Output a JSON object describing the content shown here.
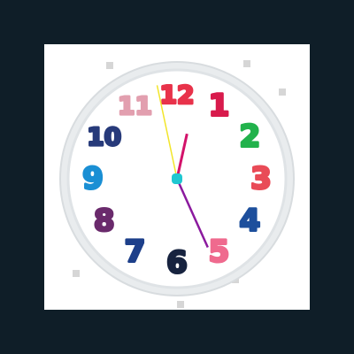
{
  "clock": {
    "numerals": [
      {
        "label": "12",
        "hour": 12,
        "color": "#e8324a"
      },
      {
        "label": "1",
        "hour": 1,
        "color": "#d81b4c"
      },
      {
        "label": "2",
        "hour": 2,
        "color": "#22b24c"
      },
      {
        "label": "3",
        "hour": 3,
        "color": "#e94b57"
      },
      {
        "label": "4",
        "hour": 4,
        "color": "#1d4f9c"
      },
      {
        "label": "5",
        "hour": 5,
        "color": "#ef6a8e"
      },
      {
        "label": "6",
        "hour": 6,
        "color": "#17233f"
      },
      {
        "label": "7",
        "hour": 7,
        "color": "#1d3f8a"
      },
      {
        "label": "8",
        "hour": 8,
        "color": "#6a2a6c"
      },
      {
        "label": "9",
        "hour": 9,
        "color": "#1a8fd4"
      },
      {
        "label": "10",
        "hour": 10,
        "color": "#273a7a"
      },
      {
        "label": "11",
        "hour": 11,
        "color": "#d97f95"
      }
    ],
    "time": {
      "hour": 12,
      "minute": 25,
      "second": 58
    },
    "colors": {
      "face": "#ffffff",
      "rim": "#e9ecee",
      "hour_hand": "#d3126a",
      "minute_hand": "#8b1a9e",
      "second_hand": "#f2e52a",
      "center_pin": "#1fc7d1"
    },
    "watermark_icon": "watermark-square-icon"
  }
}
